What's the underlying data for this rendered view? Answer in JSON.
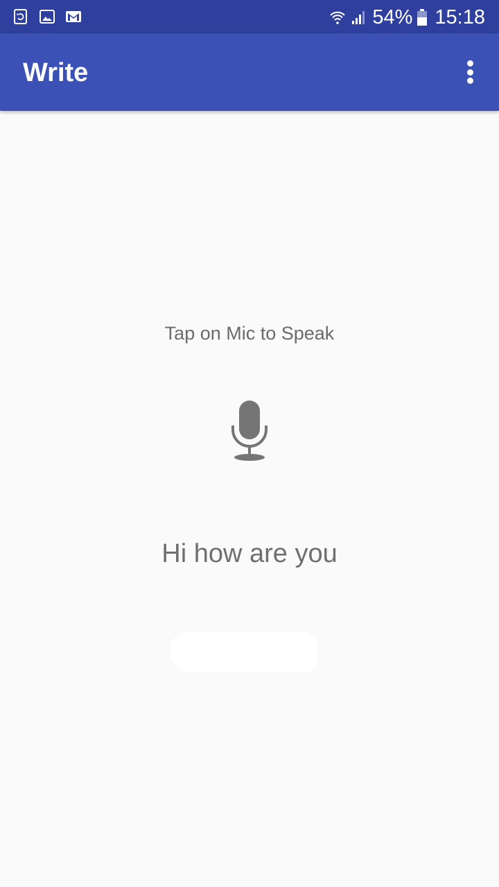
{
  "status_bar": {
    "battery_percent": "54%",
    "time": "15:18",
    "icons": [
      "screen-rotate-icon",
      "gallery-icon",
      "gmail-icon",
      "wifi-icon",
      "signal-icon",
      "battery-icon"
    ]
  },
  "app_bar": {
    "title": "Write",
    "overflow_icon": "more-vert-icon"
  },
  "main": {
    "hint": "Tap on Mic to Speak",
    "mic_icon": "microphone-icon",
    "transcript": "Hi how are you"
  },
  "colors": {
    "status_bar": "#2f3f9d",
    "app_bar": "#3c51b5",
    "background": "#fafafa",
    "text_gray": "#6f6f6f"
  }
}
